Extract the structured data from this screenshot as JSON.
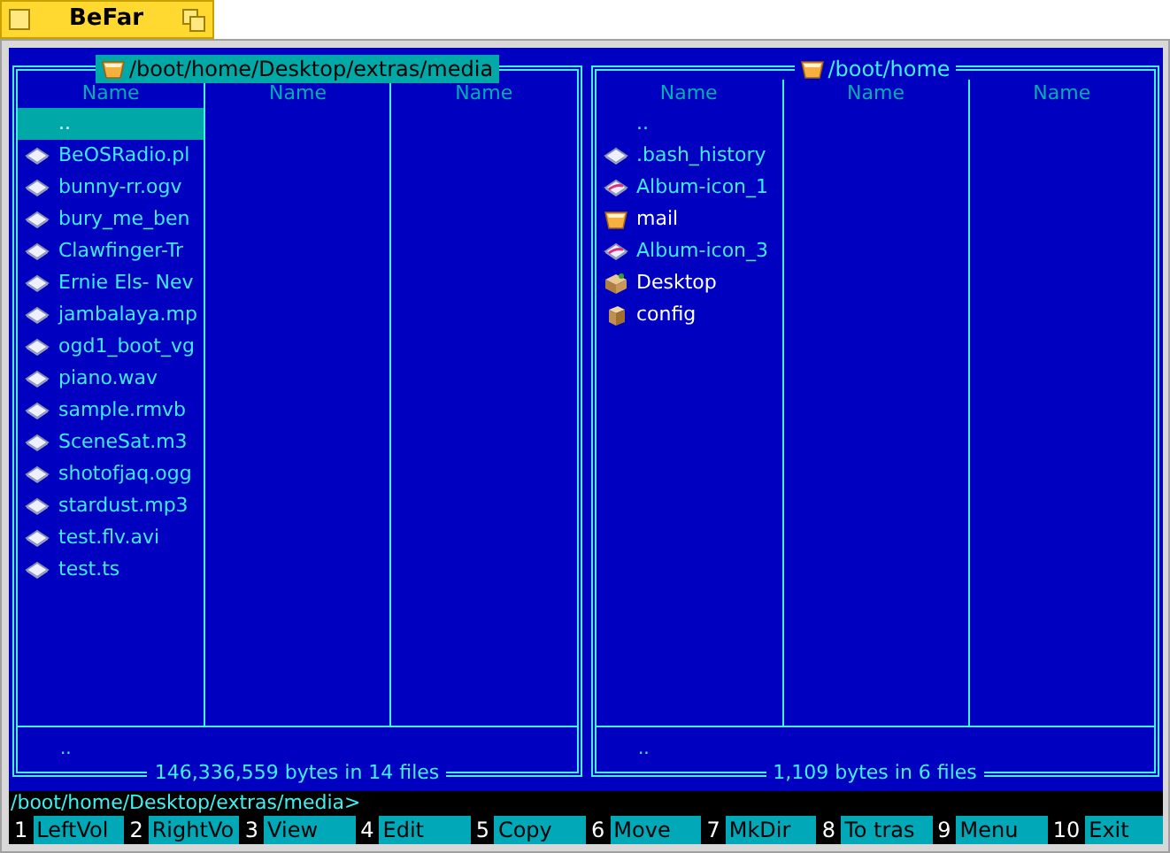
{
  "window": {
    "title": "BeFar"
  },
  "panels": [
    {
      "path": "/boot/home/Desktop/extras/media",
      "active": true,
      "columns": [
        "Name",
        "Name",
        "Name"
      ],
      "info": "..",
      "summary": "146,336,559 bytes in 14 files",
      "files": [
        {
          "name": "..",
          "kind": "parent",
          "selected": true
        },
        {
          "name": "BeOSRadio.pl",
          "kind": "file",
          "selected": false
        },
        {
          "name": "bunny-rr.ogv",
          "kind": "file",
          "selected": false
        },
        {
          "name": "bury_me_ben",
          "kind": "file",
          "selected": false
        },
        {
          "name": "Clawfinger-Tr",
          "kind": "file",
          "selected": false
        },
        {
          "name": "Ernie Els- Nev",
          "kind": "file",
          "selected": false
        },
        {
          "name": "jambalaya.mp",
          "kind": "file",
          "selected": false
        },
        {
          "name": "ogd1_boot_vg",
          "kind": "file",
          "selected": false
        },
        {
          "name": "piano.wav",
          "kind": "file",
          "selected": false
        },
        {
          "name": "sample.rmvb",
          "kind": "file",
          "selected": false
        },
        {
          "name": "SceneSat.m3",
          "kind": "file",
          "selected": false
        },
        {
          "name": "shotofjaq.ogg",
          "kind": "file",
          "selected": false
        },
        {
          "name": "stardust.mp3",
          "kind": "file",
          "selected": false
        },
        {
          "name": "test.flv.avi",
          "kind": "file",
          "selected": false
        },
        {
          "name": "test.ts",
          "kind": "file",
          "selected": false
        }
      ]
    },
    {
      "path": "/boot/home",
      "active": false,
      "columns": [
        "Name",
        "Name",
        "Name"
      ],
      "info": "..",
      "summary": "1,109 bytes in 6 files",
      "files": [
        {
          "name": "..",
          "kind": "parent",
          "selected": false
        },
        {
          "name": ".bash_history",
          "kind": "file",
          "selected": false
        },
        {
          "name": "Album-icon_1",
          "kind": "image",
          "selected": false
        },
        {
          "name": "mail",
          "kind": "folder",
          "selected": false
        },
        {
          "name": "Album-icon_3",
          "kind": "image",
          "selected": false
        },
        {
          "name": "Desktop",
          "kind": "desktop",
          "selected": false
        },
        {
          "name": "config",
          "kind": "package",
          "selected": false
        }
      ]
    }
  ],
  "command_line": "/boot/home/Desktop/extras/media>",
  "function_keys": [
    {
      "number": "1",
      "label": "LeftVol"
    },
    {
      "number": "2",
      "label": "RightVo"
    },
    {
      "number": "3",
      "label": "View"
    },
    {
      "number": "4",
      "label": "Edit"
    },
    {
      "number": "5",
      "label": "Copy"
    },
    {
      "number": "6",
      "label": "Move"
    },
    {
      "number": "7",
      "label": "MkDir"
    },
    {
      "number": "8",
      "label": "To tras"
    },
    {
      "number": "9",
      "label": "Menu"
    },
    {
      "number": "10",
      "label": "Exit"
    }
  ]
}
